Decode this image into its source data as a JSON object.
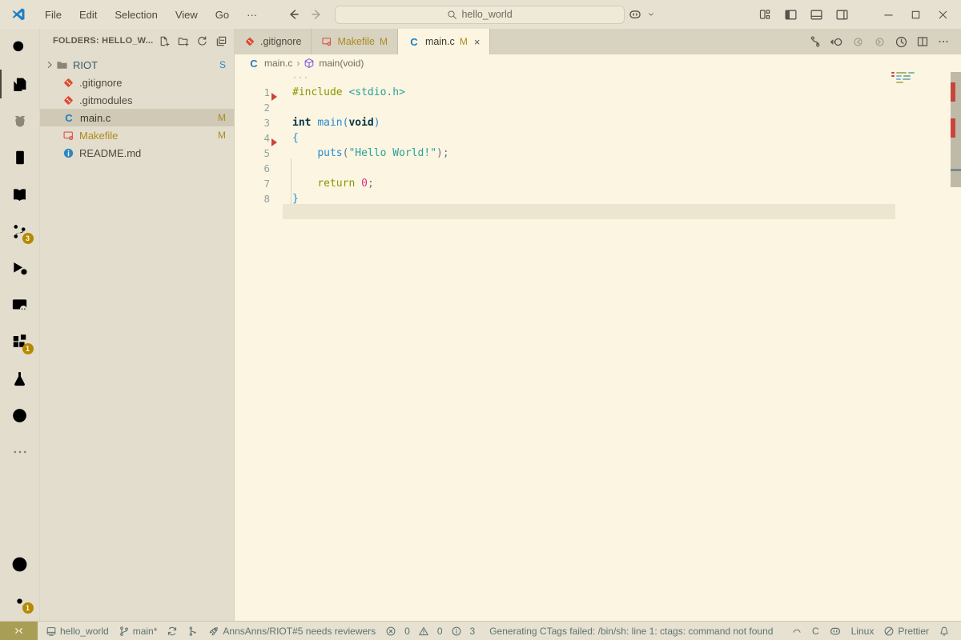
{
  "title_bar": {
    "menus": [
      "File",
      "Edit",
      "Selection",
      "View",
      "Go",
      "···"
    ],
    "search_value": "hello_world"
  },
  "activity_bar": {
    "badges": {
      "scm": "3",
      "extensions": "1",
      "settings": "1"
    }
  },
  "sidebar": {
    "header": "FOLDERS: HELLO_W...",
    "items": [
      {
        "name": "RIOT",
        "badge": "S"
      },
      {
        "name": ".gitignore",
        "badge": ""
      },
      {
        "name": ".gitmodules",
        "badge": ""
      },
      {
        "name": "main.c",
        "badge": "M"
      },
      {
        "name": "Makefile",
        "badge": "M"
      },
      {
        "name": "README.md",
        "badge": ""
      }
    ]
  },
  "tabs": [
    {
      "label": ".gitignore",
      "badge": ""
    },
    {
      "label": "Makefile",
      "badge": "M"
    },
    {
      "label": "main.c",
      "badge": "M",
      "close": "×"
    }
  ],
  "breadcrumb": {
    "file": "main.c",
    "sep": "›",
    "symbol": "main(void)"
  },
  "code": {
    "codelens": "···",
    "lines": [
      {
        "num": "1",
        "t0": "#include ",
        "t1": "<stdio.h>"
      },
      {
        "num": "2"
      },
      {
        "num": "3",
        "t0": "int ",
        "t1": "main",
        "t2": "(",
        "t3": "void",
        "t4": ")"
      },
      {
        "num": "4",
        "t0": "{"
      },
      {
        "num": "5",
        "t0": "    ",
        "t1": "puts",
        "t2": "(",
        "t3": "\"Hello World!\"",
        "t4": ");"
      },
      {
        "num": "6"
      },
      {
        "num": "7",
        "t0": "    ",
        "t1": "return ",
        "t2": "0",
        "t3": ";"
      },
      {
        "num": "8",
        "t0": "}"
      }
    ]
  },
  "status_bar": {
    "workspace": "hello_world",
    "branch": "main*",
    "pr": "AnnsAnns/RIOT#5 needs reviewers",
    "errors": "0",
    "warnings": "0",
    "infos": "3",
    "message": "Generating CTags failed: /bin/sh: line 1: ctags: command not found",
    "language": "C",
    "os": "Linux",
    "formatter": "Prettier"
  },
  "colors": {
    "chrome_bg": "#E7E1D1",
    "tabbar_bg": "#D8D2C0",
    "sidebar_bg": "#E3DDCD",
    "editor_bg": "#FCF5E2",
    "ui_text": "#4C4A3F",
    "status_text": "#5E7370",
    "accent_blue": "#1F7EC6",
    "gold": "#AD8B1E",
    "badge_bg": "#B58900",
    "red": "#C8453C",
    "git_orange": "#DD4B32",
    "makefile_red": "#D9534A",
    "info_blue": "#2E86C1",
    "purple": "#8250DF",
    "selected_row": "#CFC9B6",
    "line_highlight": "#ECE5CF",
    "remote_bg": "#A99E56",
    "syn_default": "#657B83",
    "syn_green": "#859900",
    "syn_cyan": "#2AA198",
    "syn_blue": "#268BD2",
    "syn_magenta": "#D33682",
    "syn_kw": "#073642",
    "lineno": "#93A1A1",
    "riot_text": "#3D5A66",
    "folder": "#8A8677"
  }
}
